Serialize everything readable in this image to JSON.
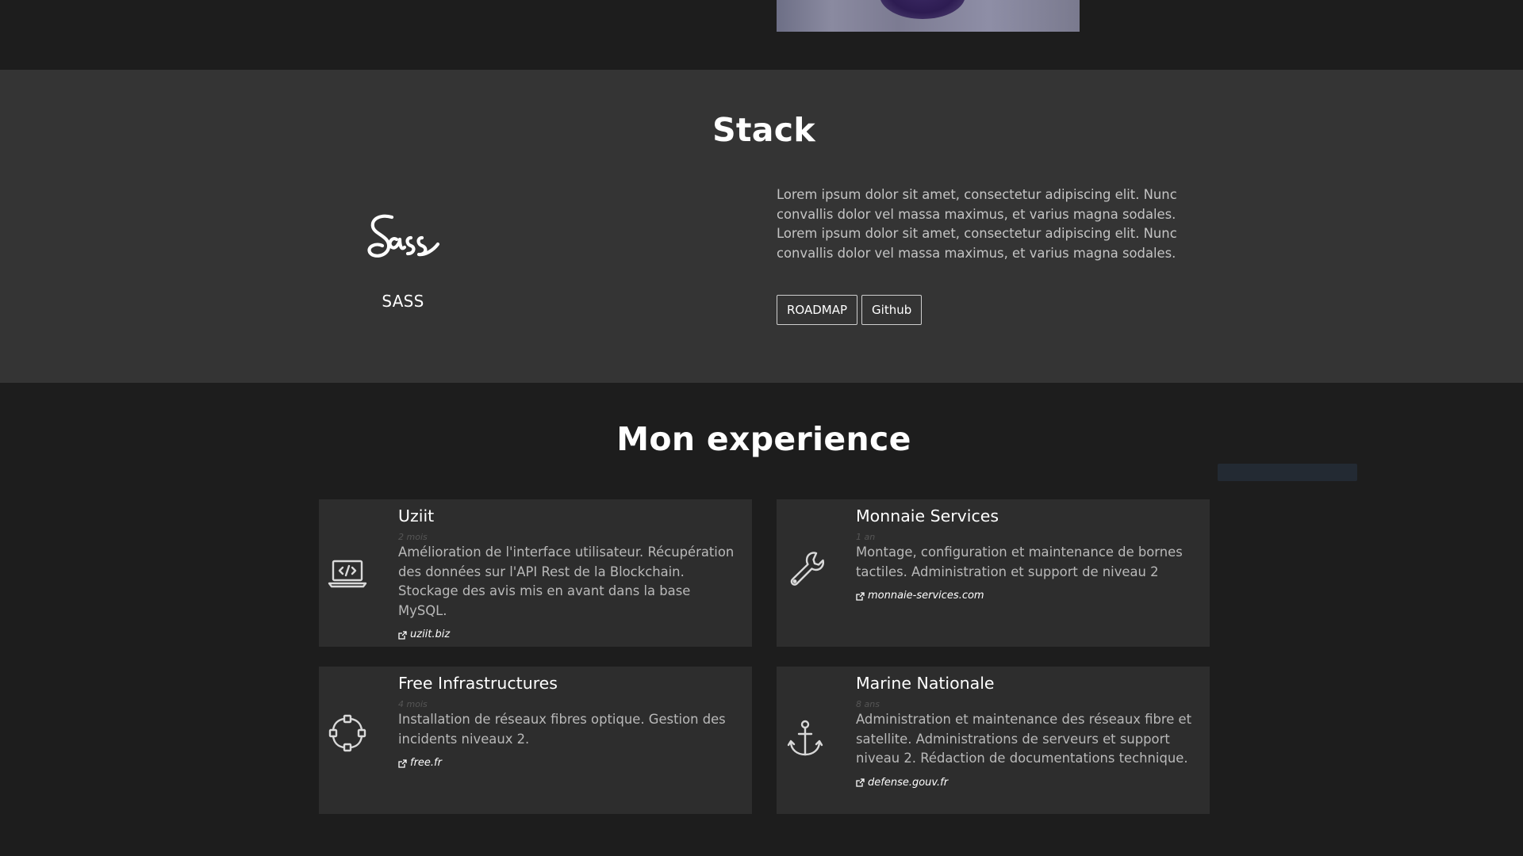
{
  "stack": {
    "title": "Stack",
    "tech_name": "SASS",
    "description": "Lorem ipsum dolor sit amet, consectetur adipiscing elit. Nunc convallis dolor vel massa maximus, et varius magna sodales. Lorem ipsum dolor sit amet, consectetur adipiscing elit. Nunc convallis dolor vel massa maximus, et varius magna sodales.",
    "buttons": {
      "roadmap": "ROADMAP",
      "github": "Github"
    }
  },
  "experience": {
    "title": "Mon experience",
    "items": [
      {
        "company": "Uziit",
        "duration": "2 mois",
        "description": "Amélioration de l'interface utilisateur. Récupération des données sur l'API Rest de la Blockchain. Stockage des avis mis en avant dans la base MySQL.",
        "link": "uziit.biz",
        "icon": "laptop-code-icon"
      },
      {
        "company": "Monnaie Services",
        "duration": "1 an",
        "description": "Montage, configuration et maintenance de bornes tactiles. Administration et support de niveau 2",
        "link": "monnaie-services.com",
        "icon": "wrench-icon"
      },
      {
        "company": "Free Infrastructures",
        "duration": "4 mois",
        "description": "Installation de réseaux fibres optique. Gestion des incidents niveaux 2.",
        "link": "free.fr",
        "icon": "network-icon"
      },
      {
        "company": "Marine Nationale",
        "duration": "8 ans",
        "description": "Administration et maintenance des réseaux fibre et satellite. Administrations de serveurs et support niveau 2. Rédaction de documentations technique.",
        "link": "defense.gouv.fr",
        "icon": "anchor-icon"
      }
    ]
  },
  "colors": {
    "page_background": "#1d1d1d",
    "stack_background": "#343434",
    "card_background": "#2d2d2d",
    "text_primary": "#ffffff",
    "text_secondary": "#c4c4c4"
  }
}
